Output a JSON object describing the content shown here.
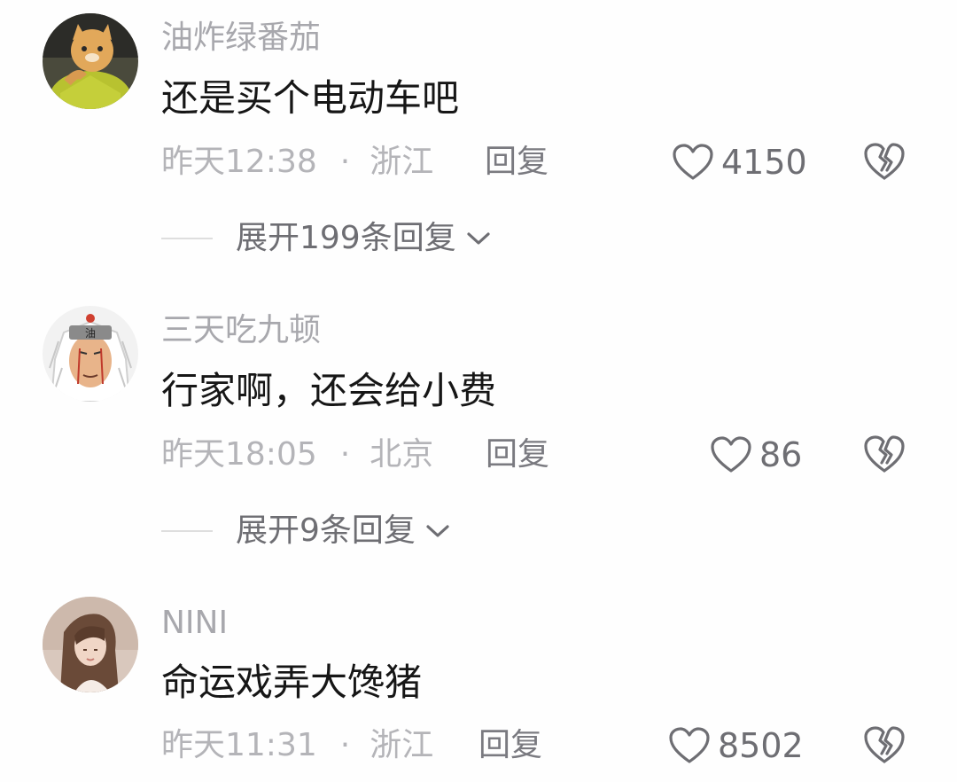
{
  "comments": [
    {
      "username": "油炸绿番茄",
      "text": "还是买个电动车吧",
      "time": "昨天12:38",
      "separator": "·",
      "location": "浙江",
      "reply_label": "回复",
      "likes": "4150",
      "expand_label": "展开199条回复",
      "avatar_icon": "cat-in-green-jacket-avatar"
    },
    {
      "username": "三天吃九顿",
      "text": "行家啊，还会给小费",
      "time": "昨天18:05",
      "separator": "·",
      "location": "北京",
      "reply_label": "回复",
      "likes": "86",
      "expand_label": "展开9条回复",
      "avatar_icon": "cartoon-ninja-avatar",
      "avatar_headband_text": "油"
    },
    {
      "username": "NINI",
      "text": "命运戏弄大馋猪",
      "time": "昨天11:31",
      "separator": "·",
      "location": "浙江",
      "reply_label": "回复",
      "likes": "8502",
      "avatar_icon": "girl-photo-avatar"
    }
  ],
  "colors": {
    "username": "#a8a8ad",
    "text": "#161616",
    "meta": "#b4b4b8",
    "action": "#7a7a80"
  }
}
